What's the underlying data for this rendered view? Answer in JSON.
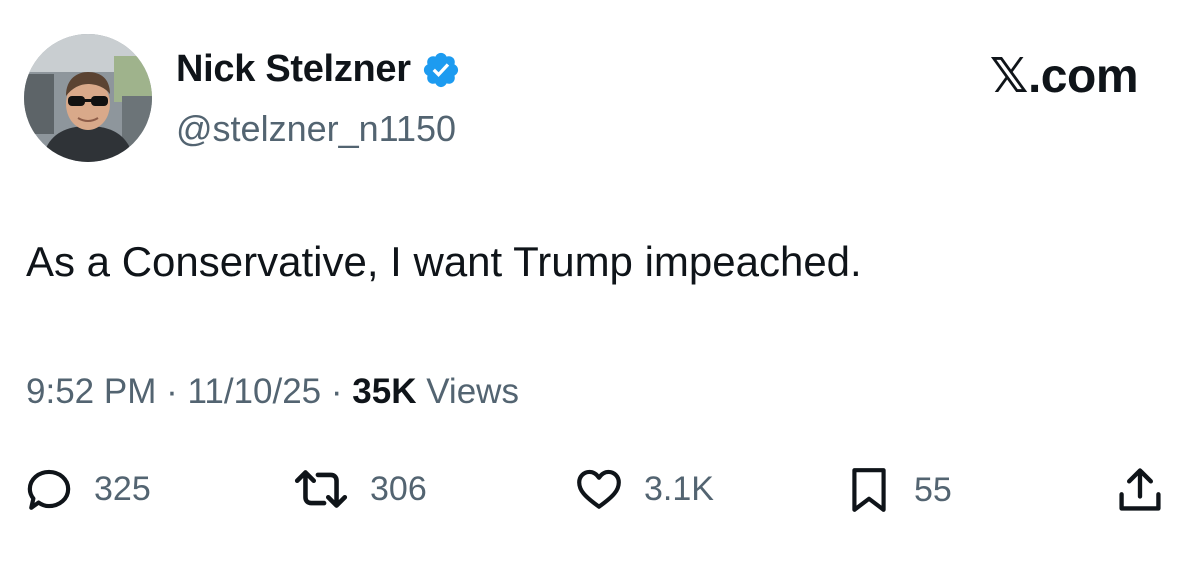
{
  "author": {
    "display_name": "Nick Stelzner",
    "handle": "@stelzner_n1150",
    "verified_icon": "verified-badge-icon",
    "avatar_icon": "profile-photo"
  },
  "brand": {
    "label": "𝕏.com"
  },
  "tweet": {
    "text": "As a Conservative, I want Trump impeached."
  },
  "meta": {
    "time": "9:52 PM",
    "separator": "·",
    "date": "11/10/25",
    "views_count": "35K",
    "views_label": "Views"
  },
  "actions": {
    "replies": {
      "icon": "reply-icon",
      "count": "325"
    },
    "reposts": {
      "icon": "repost-icon",
      "count": "306"
    },
    "likes": {
      "icon": "heart-icon",
      "count": "3.1K"
    },
    "bookmarks": {
      "icon": "bookmark-icon",
      "count": "55"
    },
    "share": {
      "icon": "share-icon"
    }
  },
  "colors": {
    "text_primary": "#0f1419",
    "text_secondary": "#536471",
    "verified": "#1d9bf0"
  }
}
